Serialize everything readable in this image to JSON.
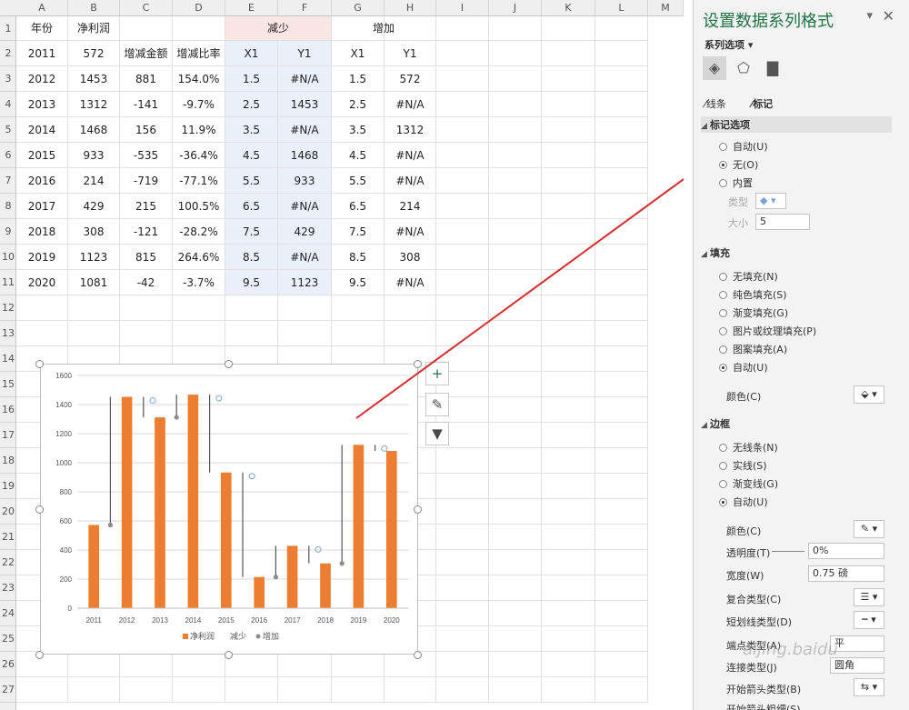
{
  "sheet": {
    "columns": [
      "A",
      "B",
      "C",
      "D",
      "E",
      "F",
      "G",
      "H",
      "I",
      "J",
      "K",
      "L",
      "M"
    ],
    "rows": [
      "1",
      "2",
      "3",
      "4",
      "5",
      "6",
      "7",
      "8",
      "9",
      "10",
      "11",
      "12",
      "13",
      "14",
      "15",
      "16",
      "17",
      "18",
      "19",
      "20",
      "21",
      "22",
      "23",
      "24",
      "25",
      "26",
      "27"
    ],
    "header": {
      "year": "年份",
      "net_profit": "净利润",
      "change_amount": "增减金额",
      "change_rate": "增减比率",
      "decrease": "减少",
      "increase": "增加",
      "x1": "X1",
      "y1": "Y1",
      "x1b": "X1",
      "y1b": "Y1"
    },
    "data": [
      [
        "2011",
        "572",
        "",
        "",
        "",
        "",
        "",
        "",
        ""
      ],
      [
        "2012",
        "1453",
        "881",
        "154.0%",
        "1.5",
        "#N/A",
        "1.5",
        "572"
      ],
      [
        "2013",
        "1312",
        "-141",
        "-9.7%",
        "2.5",
        "1453",
        "2.5",
        "#N/A"
      ],
      [
        "2014",
        "1468",
        "156",
        "11.9%",
        "3.5",
        "#N/A",
        "3.5",
        "1312"
      ],
      [
        "2015",
        "933",
        "-535",
        "-36.4%",
        "4.5",
        "1468",
        "4.5",
        "#N/A"
      ],
      [
        "2016",
        "214",
        "-719",
        "-77.1%",
        "5.5",
        "933",
        "5.5",
        "#N/A"
      ],
      [
        "2017",
        "429",
        "215",
        "100.5%",
        "6.5",
        "#N/A",
        "6.5",
        "214"
      ],
      [
        "2018",
        "308",
        "-121",
        "-28.2%",
        "7.5",
        "429",
        "7.5",
        "#N/A"
      ],
      [
        "2019",
        "1123",
        "815",
        "264.6%",
        "8.5",
        "#N/A",
        "8.5",
        "308"
      ],
      [
        "2020",
        "1081",
        "-42",
        "-3.7%",
        "9.5",
        "1123",
        "9.5",
        "#N/A"
      ]
    ]
  },
  "chart_data": {
    "type": "bar",
    "categories": [
      "2011",
      "2012",
      "2013",
      "2014",
      "2015",
      "2016",
      "2017",
      "2018",
      "2019",
      "2020"
    ],
    "series": [
      {
        "name": "净利润",
        "values": [
          572,
          1453,
          1312,
          1468,
          933,
          214,
          429,
          308,
          1123,
          1081
        ],
        "color": "#ED7D31"
      }
    ],
    "legend": [
      "净利润",
      "减少",
      "增加"
    ],
    "legend_position": "bottom",
    "ylim": [
      0,
      1600
    ],
    "yticks": [
      "0",
      "200",
      "400",
      "600",
      "800",
      "1000",
      "1200",
      "1400",
      "1600"
    ],
    "grid": true
  },
  "chart_tools": {
    "add": "+",
    "brush": "✎",
    "filter": "▼"
  },
  "pane": {
    "title": "设置数据系列格式",
    "series_options": "系列选项 ▾",
    "tab_line": "线条",
    "tab_marker": "标记",
    "marker_section": "标记选项",
    "marker_auto": "自动(U)",
    "marker_none": "无(O)",
    "marker_builtin": "内置",
    "type_label": "类型",
    "size_label": "大小",
    "size_value": "5",
    "fill_section": "填充",
    "fill_none": "无填充(N)",
    "fill_solid": "纯色填充(S)",
    "fill_gradient": "渐变填充(G)",
    "fill_picture": "图片或纹理填充(P)",
    "fill_pattern": "图案填充(A)",
    "fill_auto": "自动(U)",
    "fill_color": "颜色(C)",
    "border_section": "边框",
    "border_none": "无线条(N)",
    "border_solid": "实线(S)",
    "border_gradient": "渐变线(G)",
    "border_auto": "自动(U)",
    "border_color": "颜色(C)",
    "transparency": "透明度(T)",
    "transparency_value": "0%",
    "width": "宽度(W)",
    "width_value": "0.75 磅",
    "compound": "复合类型(C)",
    "dash": "短划线类型(D)",
    "cap": "端点类型(A)",
    "cap_value": "平",
    "join": "连接类型(J)",
    "join_value": "圆角",
    "arrow_begin": "开始箭头类型(B)",
    "arrow_begin_size": "开始箭头粗细(S)",
    "watermark": "aijing.baidu"
  },
  "colors": {
    "accent": "#217346",
    "bar": "#ED7D31",
    "arrow": "#D62B2B"
  }
}
